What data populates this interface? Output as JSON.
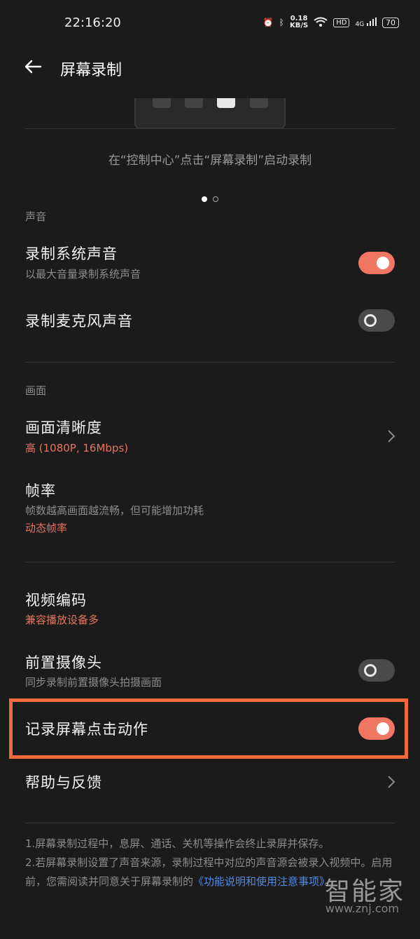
{
  "status_bar": {
    "time": "22:16:20",
    "net_speed": "0.18",
    "net_unit": "KB/S",
    "hd_badge": "HD",
    "signal_label": "4G",
    "battery": "70"
  },
  "header": {
    "title": "屏幕录制"
  },
  "preview": {
    "hint": "在“控制中心”点击“屏幕录制”启动录制"
  },
  "sound": {
    "section_label": "声音",
    "system_audio": {
      "label": "录制系统声音",
      "sub": "以最大音量录制系统声音",
      "enabled": true
    },
    "mic_audio": {
      "label": "录制麦克风声音",
      "enabled": false
    }
  },
  "picture": {
    "section_label": "画面",
    "resolution": {
      "label": "画面清晰度",
      "value": "高 (1080P, 16Mbps)"
    },
    "frame_rate": {
      "label": "帧率",
      "sub": "帧数越高画面越流畅，但可能增加功耗",
      "value": "动态帧率"
    }
  },
  "other": {
    "codec": {
      "label": "视频编码",
      "value": "兼容播放设备多"
    },
    "front_camera": {
      "label": "前置摄像头",
      "sub": "同步录制前置摄像头拍摄画面",
      "enabled": false
    },
    "touch_actions": {
      "label": "记录屏幕点击动作",
      "enabled": true
    },
    "help": {
      "label": "帮助与反馈"
    }
  },
  "notes": {
    "line1": "1.屏幕录制过程中，息屏、通话、关机等操作会终止录屏并保存。",
    "line2": "2.若屏幕录制设置了声音来源，录制过程中对应的声音源会被录入视频中。启用前，您需阅读并同意关于屏幕录制的",
    "link": "《功能说明和使用注意事项》",
    "line2_end": "。"
  },
  "watermark": {
    "text": "智能家",
    "site": "www.znj.com"
  },
  "colors": {
    "accent": "#f07763",
    "highlight": "#f16a3c",
    "link": "#4f8be6"
  }
}
